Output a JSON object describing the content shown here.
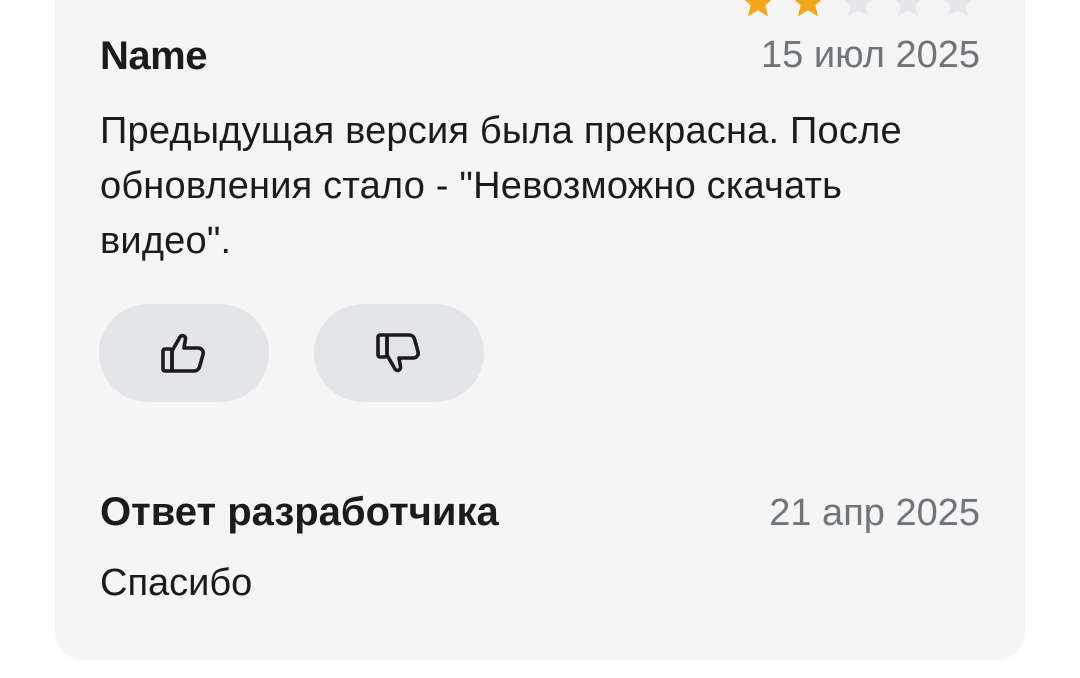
{
  "review": {
    "author": "Name",
    "date": "15 июл 2025",
    "rating": 2,
    "rating_max": 5,
    "text": "Предыдущая версия была прекрасна. После обновления стало - \"Невозможно скачать видео\"."
  },
  "actions": {
    "like_icon": "thumbs-up-icon",
    "dislike_icon": "thumbs-down-icon"
  },
  "developer_reply": {
    "title": "Ответ разработчика",
    "date": "21 апр 2025",
    "text": "Спасибо"
  },
  "colors": {
    "star_filled": "#f4a718",
    "star_empty": "#e6e7ea",
    "card_background": "#f5f5f6",
    "button_background": "#e3e5e8",
    "date_text": "#70757c"
  }
}
